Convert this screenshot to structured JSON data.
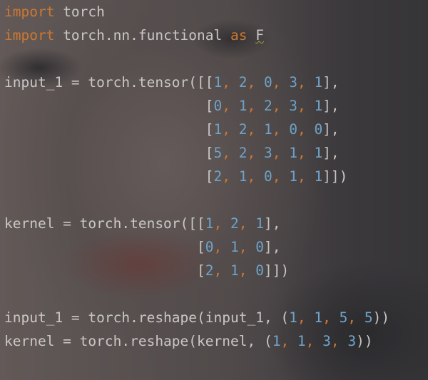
{
  "editor": {
    "lines": [
      [
        {
          "t": "import",
          "c": "kw"
        },
        {
          "t": " torch",
          "c": "pun"
        }
      ],
      [
        {
          "t": "import",
          "c": "kw"
        },
        {
          "t": " torch.nn.functional ",
          "c": "pun"
        },
        {
          "t": "as",
          "c": "kw"
        },
        {
          "t": " ",
          "c": "pun"
        },
        {
          "t": "F",
          "c": "alias"
        }
      ],
      [],
      [
        {
          "t": "input_1 = torch.tensor([[",
          "c": "pun"
        },
        {
          "t": "1",
          "c": "num"
        },
        {
          "t": ", ",
          "c": "kw"
        },
        {
          "t": "2",
          "c": "num"
        },
        {
          "t": ", ",
          "c": "kw"
        },
        {
          "t": "0",
          "c": "num"
        },
        {
          "t": ", ",
          "c": "kw"
        },
        {
          "t": "3",
          "c": "num"
        },
        {
          "t": ", ",
          "c": "kw"
        },
        {
          "t": "1",
          "c": "num"
        },
        {
          "t": "],",
          "c": "pun"
        }
      ],
      [
        {
          "t": "                        [",
          "c": "pun"
        },
        {
          "t": "0",
          "c": "num"
        },
        {
          "t": ", ",
          "c": "kw"
        },
        {
          "t": "1",
          "c": "num"
        },
        {
          "t": ", ",
          "c": "kw"
        },
        {
          "t": "2",
          "c": "num"
        },
        {
          "t": ", ",
          "c": "kw"
        },
        {
          "t": "3",
          "c": "num"
        },
        {
          "t": ", ",
          "c": "kw"
        },
        {
          "t": "1",
          "c": "num"
        },
        {
          "t": "],",
          "c": "pun"
        }
      ],
      [
        {
          "t": "                        [",
          "c": "pun"
        },
        {
          "t": "1",
          "c": "num"
        },
        {
          "t": ", ",
          "c": "kw"
        },
        {
          "t": "2",
          "c": "num"
        },
        {
          "t": ", ",
          "c": "kw"
        },
        {
          "t": "1",
          "c": "num"
        },
        {
          "t": ", ",
          "c": "kw"
        },
        {
          "t": "0",
          "c": "num"
        },
        {
          "t": ", ",
          "c": "kw"
        },
        {
          "t": "0",
          "c": "num"
        },
        {
          "t": "],",
          "c": "pun"
        }
      ],
      [
        {
          "t": "                        [",
          "c": "pun"
        },
        {
          "t": "5",
          "c": "num"
        },
        {
          "t": ", ",
          "c": "kw"
        },
        {
          "t": "2",
          "c": "num"
        },
        {
          "t": ", ",
          "c": "kw"
        },
        {
          "t": "3",
          "c": "num"
        },
        {
          "t": ", ",
          "c": "kw"
        },
        {
          "t": "1",
          "c": "num"
        },
        {
          "t": ", ",
          "c": "kw"
        },
        {
          "t": "1",
          "c": "num"
        },
        {
          "t": "],",
          "c": "pun"
        }
      ],
      [
        {
          "t": "                        [",
          "c": "pun"
        },
        {
          "t": "2",
          "c": "num"
        },
        {
          "t": ", ",
          "c": "kw"
        },
        {
          "t": "1",
          "c": "num"
        },
        {
          "t": ", ",
          "c": "kw"
        },
        {
          "t": "0",
          "c": "num"
        },
        {
          "t": ", ",
          "c": "kw"
        },
        {
          "t": "1",
          "c": "num"
        },
        {
          "t": ", ",
          "c": "kw"
        },
        {
          "t": "1",
          "c": "num"
        },
        {
          "t": "]])",
          "c": "pun"
        }
      ],
      [],
      [
        {
          "t": "kernel = torch.tensor([[",
          "c": "pun"
        },
        {
          "t": "1",
          "c": "num"
        },
        {
          "t": ", ",
          "c": "kw"
        },
        {
          "t": "2",
          "c": "num"
        },
        {
          "t": ", ",
          "c": "kw"
        },
        {
          "t": "1",
          "c": "num"
        },
        {
          "t": "],",
          "c": "pun"
        }
      ],
      [
        {
          "t": "                       [",
          "c": "pun"
        },
        {
          "t": "0",
          "c": "num"
        },
        {
          "t": ", ",
          "c": "kw"
        },
        {
          "t": "1",
          "c": "num"
        },
        {
          "t": ", ",
          "c": "kw"
        },
        {
          "t": "0",
          "c": "num"
        },
        {
          "t": "],",
          "c": "pun"
        }
      ],
      [
        {
          "t": "                       [",
          "c": "pun"
        },
        {
          "t": "2",
          "c": "num"
        },
        {
          "t": ", ",
          "c": "kw"
        },
        {
          "t": "1",
          "c": "num"
        },
        {
          "t": ", ",
          "c": "kw"
        },
        {
          "t": "0",
          "c": "num"
        },
        {
          "t": "]])",
          "c": "pun"
        }
      ],
      [],
      [
        {
          "t": "input_1 = torch.reshape(input_1, (",
          "c": "pun"
        },
        {
          "t": "1",
          "c": "num"
        },
        {
          "t": ", ",
          "c": "kw"
        },
        {
          "t": "1",
          "c": "num"
        },
        {
          "t": ", ",
          "c": "kw"
        },
        {
          "t": "5",
          "c": "num"
        },
        {
          "t": ", ",
          "c": "kw"
        },
        {
          "t": "5",
          "c": "num"
        },
        {
          "t": "))",
          "c": "pun"
        }
      ],
      [
        {
          "t": "kernel = torch.reshape(kernel, (",
          "c": "pun"
        },
        {
          "t": "1",
          "c": "num"
        },
        {
          "t": ", ",
          "c": "kw"
        },
        {
          "t": "1",
          "c": "num"
        },
        {
          "t": ", ",
          "c": "kw"
        },
        {
          "t": "3",
          "c": "num"
        },
        {
          "t": ", ",
          "c": "kw"
        },
        {
          "t": "3",
          "c": "num"
        },
        {
          "t": "))",
          "c": "pun"
        }
      ]
    ]
  },
  "colors": {
    "keyword": "#cc7832",
    "number": "#6fa3c8",
    "text": "#c9c7c5"
  }
}
